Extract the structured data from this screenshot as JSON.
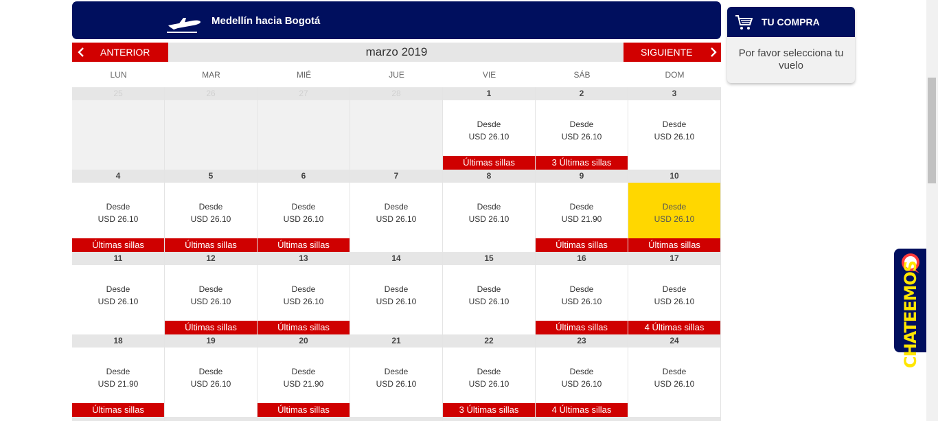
{
  "route": {
    "title": "Medellín hacia Bogotá"
  },
  "nav": {
    "prev_label": "ANTERIOR",
    "next_label": "SIGUIENTE",
    "month_title": "marzo 2019"
  },
  "weekdays": [
    "LUN",
    "MAR",
    "MIÉ",
    "JUE",
    "VIE",
    "SÁB",
    "DOM"
  ],
  "calendar": {
    "from_label": "Desde",
    "selected_day": "10",
    "weeks": [
      [
        {
          "day": "25",
          "empty": true
        },
        {
          "day": "26",
          "empty": true
        },
        {
          "day": "27",
          "empty": true
        },
        {
          "day": "28",
          "empty": true
        },
        {
          "day": "1",
          "price": "USD 26.10",
          "tag": "Últimas sillas"
        },
        {
          "day": "2",
          "price": "USD 26.10",
          "tag": "3 Últimas sillas"
        },
        {
          "day": "3",
          "price": "USD 26.10",
          "tag": ""
        }
      ],
      [
        {
          "day": "4",
          "price": "USD 26.10",
          "tag": "Últimas sillas"
        },
        {
          "day": "5",
          "price": "USD 26.10",
          "tag": "Últimas sillas"
        },
        {
          "day": "6",
          "price": "USD 26.10",
          "tag": "Últimas sillas"
        },
        {
          "day": "7",
          "price": "USD 26.10",
          "tag": ""
        },
        {
          "day": "8",
          "price": "USD 26.10",
          "tag": ""
        },
        {
          "day": "9",
          "price": "USD 21.90",
          "tag": "Últimas sillas"
        },
        {
          "day": "10",
          "price": "USD 26.10",
          "tag": "Últimas sillas"
        }
      ],
      [
        {
          "day": "11",
          "price": "USD 26.10",
          "tag": ""
        },
        {
          "day": "12",
          "price": "USD 26.10",
          "tag": "Últimas sillas"
        },
        {
          "day": "13",
          "price": "USD 26.10",
          "tag": "Últimas sillas"
        },
        {
          "day": "14",
          "price": "USD 26.10",
          "tag": ""
        },
        {
          "day": "15",
          "price": "USD 26.10",
          "tag": ""
        },
        {
          "day": "16",
          "price": "USD 26.10",
          "tag": "Últimas sillas"
        },
        {
          "day": "17",
          "price": "USD 26.10",
          "tag": "4 Últimas sillas"
        }
      ],
      [
        {
          "day": "18",
          "price": "USD 21.90",
          "tag": "Últimas sillas"
        },
        {
          "day": "19",
          "price": "USD 26.10",
          "tag": ""
        },
        {
          "day": "20",
          "price": "USD 21.90",
          "tag": "Últimas sillas"
        },
        {
          "day": "21",
          "price": "USD 26.10",
          "tag": ""
        },
        {
          "day": "22",
          "price": "USD 26.10",
          "tag": "3 Últimas sillas"
        },
        {
          "day": "23",
          "price": "USD 26.10",
          "tag": "4 Últimas sillas"
        },
        {
          "day": "24",
          "price": "USD 26.10",
          "tag": ""
        }
      ]
    ]
  },
  "cart": {
    "title": "TU COMPRA",
    "message": "Por favor selecciona tu vuelo"
  },
  "chat": {
    "label": "CHATEEMOS"
  },
  "colors": {
    "navy": "#000f5e",
    "red": "#cf0000",
    "selected": "#ffd700",
    "chat_text": "#ffe600"
  }
}
